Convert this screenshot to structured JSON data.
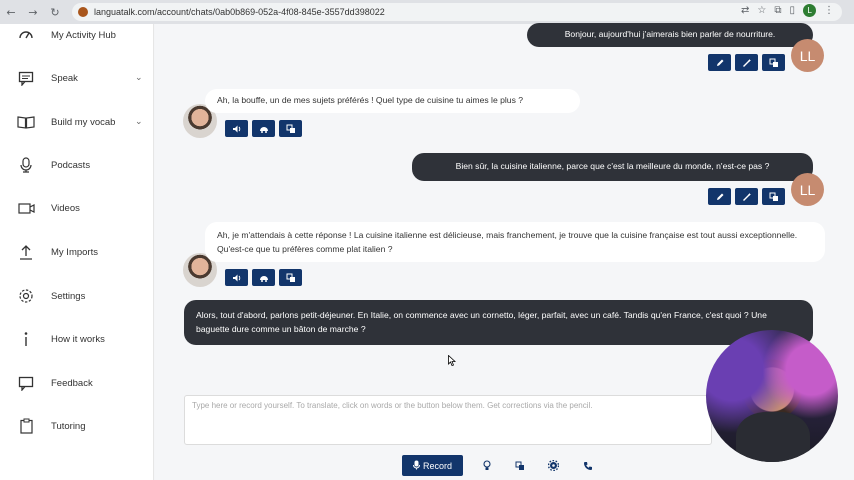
{
  "browser": {
    "url": "languatalk.com/account/chats/0ab0b869-052a-4f08-845e-3557dd398022",
    "profile_initial": "L"
  },
  "sidebar": {
    "items": [
      {
        "label": "My Activity Hub",
        "icon": "activity-icon",
        "chevron": ""
      },
      {
        "label": "Speak",
        "icon": "chat-icon",
        "chevron": "⌄"
      },
      {
        "label": "Build my vocab",
        "icon": "book-icon",
        "chevron": "⌄"
      },
      {
        "label": "Podcasts",
        "icon": "microphone-icon",
        "chevron": ""
      },
      {
        "label": "Videos",
        "icon": "video-icon",
        "chevron": ""
      },
      {
        "label": "My Imports",
        "icon": "upload-icon",
        "chevron": ""
      },
      {
        "label": "Settings",
        "icon": "gear-icon",
        "chevron": ""
      },
      {
        "label": "How it works",
        "icon": "info-icon",
        "chevron": ""
      },
      {
        "label": "Feedback",
        "icon": "feedback-icon",
        "chevron": ""
      },
      {
        "label": "Tutoring",
        "icon": "clipboard-icon",
        "chevron": ""
      }
    ]
  },
  "chat": {
    "user_initials": "LL",
    "messages": [
      {
        "role": "user",
        "text": "Bonjour, aujourd'hui j'aimerais bien parler de nourriture."
      },
      {
        "role": "bot",
        "text": "Ah, la bouffe, un de mes sujets préférés ! Quel type de cuisine tu aimes le plus ?"
      },
      {
        "role": "user",
        "text": "Bien sûr, la cuisine italienne, parce que c'est la meilleure du monde, n'est-ce pas ?"
      },
      {
        "role": "bot",
        "text": "Ah, je m'attendais à cette réponse ! La cuisine italienne est délicieuse, mais franchement, je trouve que la cuisine française est tout aussi exceptionnelle. Qu'est-ce que tu préfères comme plat italien ?"
      },
      {
        "role": "user",
        "text": "Alors, tout d'abord, parlons petit-déjeuner. En Italie, on commence avec un cornetto, léger, parfait, avec un café. Tandis qu'en France, c'est quoi ? Une baguette dure comme un bâton de marche ?"
      }
    ]
  },
  "input": {
    "placeholder": "Type here or record yourself. To translate, click on words or the button below them. Get corrections via the pencil."
  },
  "toolbar": {
    "record_label": "Record"
  },
  "colors": {
    "accent": "#12356b",
    "user_bubble": "#2f3239",
    "avatar_ll": "#c68b70"
  }
}
